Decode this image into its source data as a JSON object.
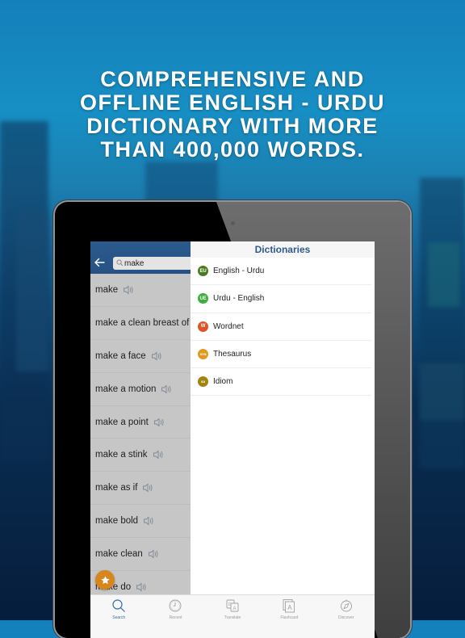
{
  "headline": {
    "lines": [
      "COMPREHENSIVE AND",
      "OFFLINE ENGLISH - URDU",
      "DICTIONARY WITH MORE",
      "THAN 400,000 WORDS."
    ]
  },
  "search": {
    "value": "make",
    "back_icon": "arrow-left-icon",
    "search_icon": "magnifier-icon"
  },
  "word_list": [
    {
      "word": "make",
      "has_audio": true
    },
    {
      "word": "make a clean breast of",
      "has_audio": true
    },
    {
      "word": "make a face",
      "has_audio": true
    },
    {
      "word": "make a motion",
      "has_audio": true
    },
    {
      "word": "make a point",
      "has_audio": true
    },
    {
      "word": "make a stink",
      "has_audio": true
    },
    {
      "word": "make as if",
      "has_audio": true
    },
    {
      "word": "make bold",
      "has_audio": true
    },
    {
      "word": "make clean",
      "has_audio": true
    },
    {
      "word": "make do",
      "has_audio": true
    }
  ],
  "favorite_button": {
    "icon": "star-icon",
    "color": "#d6861d"
  },
  "dictionaries": {
    "title": "Dictionaries",
    "items": [
      {
        "badge": "EU",
        "label": "English - Urdu",
        "color": "#4a7a1e"
      },
      {
        "badge": "UE",
        "label": "Urdu - English",
        "color": "#3fae3f"
      },
      {
        "badge": "W",
        "label": "Wordnet",
        "color": "#dc5524"
      },
      {
        "badge": "SYN",
        "label": "Thesaurus",
        "color": "#e09a22"
      },
      {
        "badge": "IDI",
        "label": "Idiom",
        "color": "#a0840f"
      }
    ]
  },
  "tabs": [
    {
      "label": "Search",
      "icon": "search-icon",
      "active": true
    },
    {
      "label": "Recent",
      "icon": "clock-icon",
      "active": false
    },
    {
      "label": "Translate",
      "icon": "translate-icon",
      "active": false
    },
    {
      "label": "Flashcard",
      "icon": "flashcard-icon",
      "active": false
    },
    {
      "label": "Discover",
      "icon": "compass-icon",
      "active": false
    }
  ],
  "colors": {
    "header_blue": "#2b5a8e",
    "title_blue": "#2e5a8e",
    "tab_active": "#3570a8"
  }
}
